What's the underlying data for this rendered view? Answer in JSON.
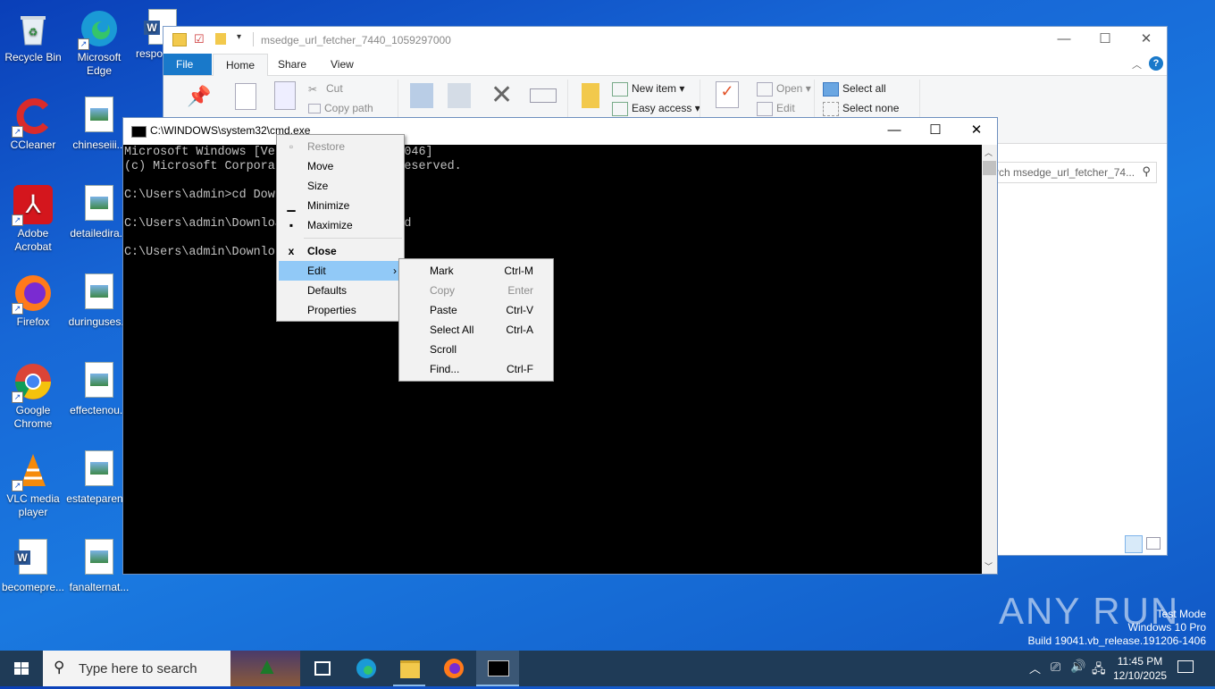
{
  "desktop": {
    "icons": [
      {
        "label": "Recycle Bin"
      },
      {
        "label": "Microsoft Edge"
      },
      {
        "label": "respo"
      },
      {
        "label": "CCleaner"
      },
      {
        "label": "chineseiii..."
      },
      {
        "label": "Adobe Acrobat"
      },
      {
        "label": "detailedira..."
      },
      {
        "label": "Firefox"
      },
      {
        "label": "duringuses..."
      },
      {
        "label": "Google Chrome"
      },
      {
        "label": "effectenou..."
      },
      {
        "label": "VLC media player"
      },
      {
        "label": "estateparen..."
      },
      {
        "label": "becomepre..."
      },
      {
        "label": "fanalternat..."
      }
    ]
  },
  "explorer": {
    "title": "msedge_url_fetcher_7440_1059297000",
    "tabs": [
      "File",
      "Home",
      "Share",
      "View"
    ],
    "ribbon": {
      "cut": "Cut",
      "copy_path": "Copy path",
      "new_item": "New item",
      "easy_access": "Easy access",
      "open": "Open",
      "edit": "Edit",
      "select_all": "Select all",
      "select_none": "Select none"
    },
    "search_placeholder": "rch msedge_url_fetcher_74..."
  },
  "cmd": {
    "title": "C:\\WINDOWS\\system32\\cmd.exe",
    "lines": [
      "Microsoft Windows [Ver                 046]",
      "(c) Microsoft Corporat                 eserved.",
      "",
      "C:\\Users\\admin>cd Down",
      "",
      "C:\\Users\\admin\\Downloa                 d",
      "",
      "C:\\Users\\admin\\Downlo"
    ]
  },
  "system_menu": {
    "items": [
      {
        "label": "Restore",
        "glyph": "▫",
        "disabled": true
      },
      {
        "label": "Move",
        "glyph": ""
      },
      {
        "label": "Size",
        "glyph": ""
      },
      {
        "label": "Minimize",
        "glyph": "▁"
      },
      {
        "label": "Maximize",
        "glyph": "▪"
      },
      {
        "label": "Close",
        "glyph": "x"
      },
      {
        "label": "Edit",
        "glyph": "",
        "arrow": "›"
      },
      {
        "label": "Defaults",
        "glyph": ""
      },
      {
        "label": "Properties",
        "glyph": ""
      }
    ]
  },
  "edit_submenu": {
    "items": [
      {
        "label": "Mark",
        "shortcut": "Ctrl-M"
      },
      {
        "label": "Copy",
        "shortcut": "Enter",
        "disabled": true
      },
      {
        "label": "Paste",
        "shortcut": "Ctrl-V"
      },
      {
        "label": "Select All",
        "shortcut": "Ctrl-A"
      },
      {
        "label": "Scroll",
        "shortcut": ""
      },
      {
        "label": "Find...",
        "shortcut": "Ctrl-F"
      }
    ]
  },
  "watermark": {
    "brand": "ANY RUN",
    "mode": "Test Mode",
    "os": "Windows 10 Pro",
    "build": "Build 19041.vb_release.191206-1406"
  },
  "taskbar": {
    "search_placeholder": "Type here to search",
    "time": "11:45 PM",
    "date": "12/10/2025"
  },
  "colors": {
    "menu_highlight": "#91c9f7",
    "file_tab": "#1979ca",
    "taskbar": "#1f3b57"
  }
}
